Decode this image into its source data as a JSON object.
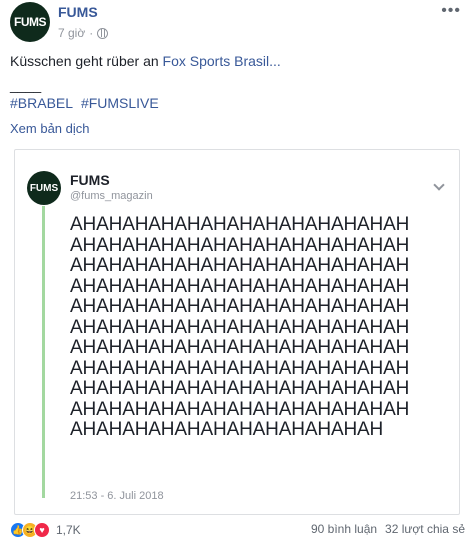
{
  "post": {
    "author": "FUMS",
    "avatar_text": "FUMS",
    "time": "7 giờ",
    "privacy_icon": "globe-icon",
    "more_icon": "ellipsis-icon",
    "text_prefix": "Küsschen geht rüber an ",
    "text_link": "Fox Sports Brasil...",
    "divider": "____",
    "hashtags": [
      "#BRABEL",
      "#FUMSLIVE"
    ],
    "translate": "Xem bản dịch"
  },
  "tweet": {
    "avatar_text": "FUMS",
    "name": "FUMS",
    "handle": "@fums_magazin",
    "lines": [
      "AHAHAHAHAHAHAHAHAHAHAHAHAH",
      "AHAHAHAHAHAHAHAHAHAHAHAHAH",
      "AHAHAHAHAHAHAHAHAHAHAHAHAH",
      "AHAHAHAHAHAHAHAHAHAHAHAHAH",
      "AHAHAHAHAHAHAHAHAHAHAHAHAH",
      "AHAHAHAHAHAHAHAHAHAHAHAHAH",
      "AHAHAHAHAHAHAHAHAHAHAHAHAH",
      "AHAHAHAHAHAHAHAHAHAHAHAHAH",
      "AHAHAHAHAHAHAHAHAHAHAHAHAH",
      "AHAHAHAHAHAHAHAHAHAHAHAHAH",
      "AHAHAHAHAHAHAHAHAHAHAHAH"
    ],
    "timestamp": "21:53 - 6. Juli 2018"
  },
  "footer": {
    "reaction_count": "1,7K",
    "comments": "90 bình luận",
    "shares": "32 lượt chia sẻ"
  },
  "colors": {
    "link": "#385898",
    "muted": "#90949c",
    "thread": "#a3d8a0",
    "avatar_bg": "#0f2a1c"
  }
}
